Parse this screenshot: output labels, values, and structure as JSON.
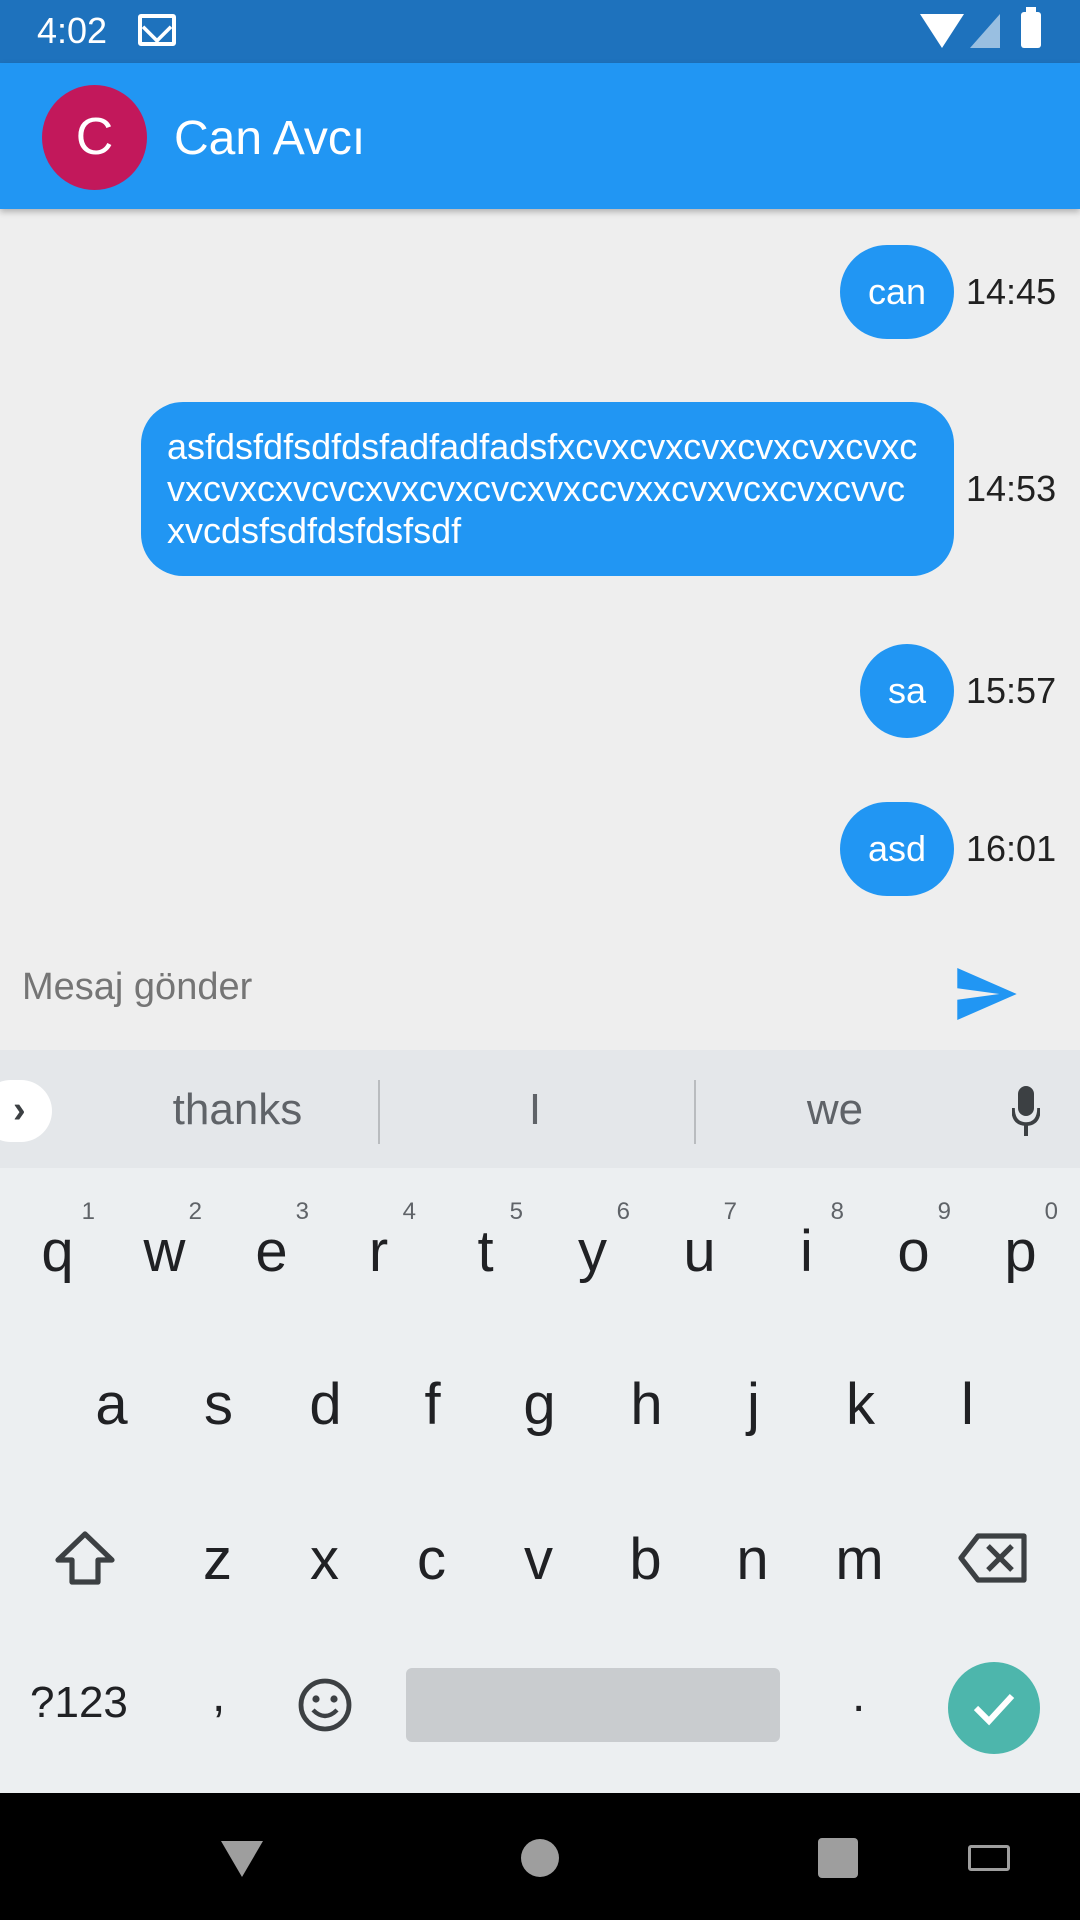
{
  "status_bar": {
    "time": "4:02"
  },
  "app_bar": {
    "avatar_letter": "C",
    "contact_name": "Can Avcı"
  },
  "messages": [
    {
      "text": "can",
      "time": "14:45"
    },
    {
      "text": "asfdsfdfsdfdsfadfadfadsfxcvxcvxcvxcvxcvxcvxcvxcvxcxvcvcxvxcvxcvcxvxccvxxcvxvcxcvxcvvcxvcdsfsdfdsfdsfsdf",
      "time": "14:53"
    },
    {
      "text": "sa",
      "time": "15:57"
    },
    {
      "text": "asd",
      "time": "16:01"
    }
  ],
  "composer": {
    "placeholder": "Mesaj gönder"
  },
  "keyboard": {
    "suggestions": [
      "thanks",
      "I",
      "we"
    ],
    "row1": [
      {
        "l": "q",
        "h": "1"
      },
      {
        "l": "w",
        "h": "2"
      },
      {
        "l": "e",
        "h": "3"
      },
      {
        "l": "r",
        "h": "4"
      },
      {
        "l": "t",
        "h": "5"
      },
      {
        "l": "y",
        "h": "6"
      },
      {
        "l": "u",
        "h": "7"
      },
      {
        "l": "i",
        "h": "8"
      },
      {
        "l": "o",
        "h": "9"
      },
      {
        "l": "p",
        "h": "0"
      }
    ],
    "row2": [
      "a",
      "s",
      "d",
      "f",
      "g",
      "h",
      "j",
      "k",
      "l"
    ],
    "row3": [
      "z",
      "x",
      "c",
      "v",
      "b",
      "n",
      "m"
    ],
    "symbols_label": "?123",
    "comma_label": ",",
    "period_label": ".",
    "enter_color": "#4db6ac"
  },
  "colors": {
    "accent": "#2196f3",
    "status_bar": "#1e72bd",
    "avatar": "#c2185b"
  }
}
